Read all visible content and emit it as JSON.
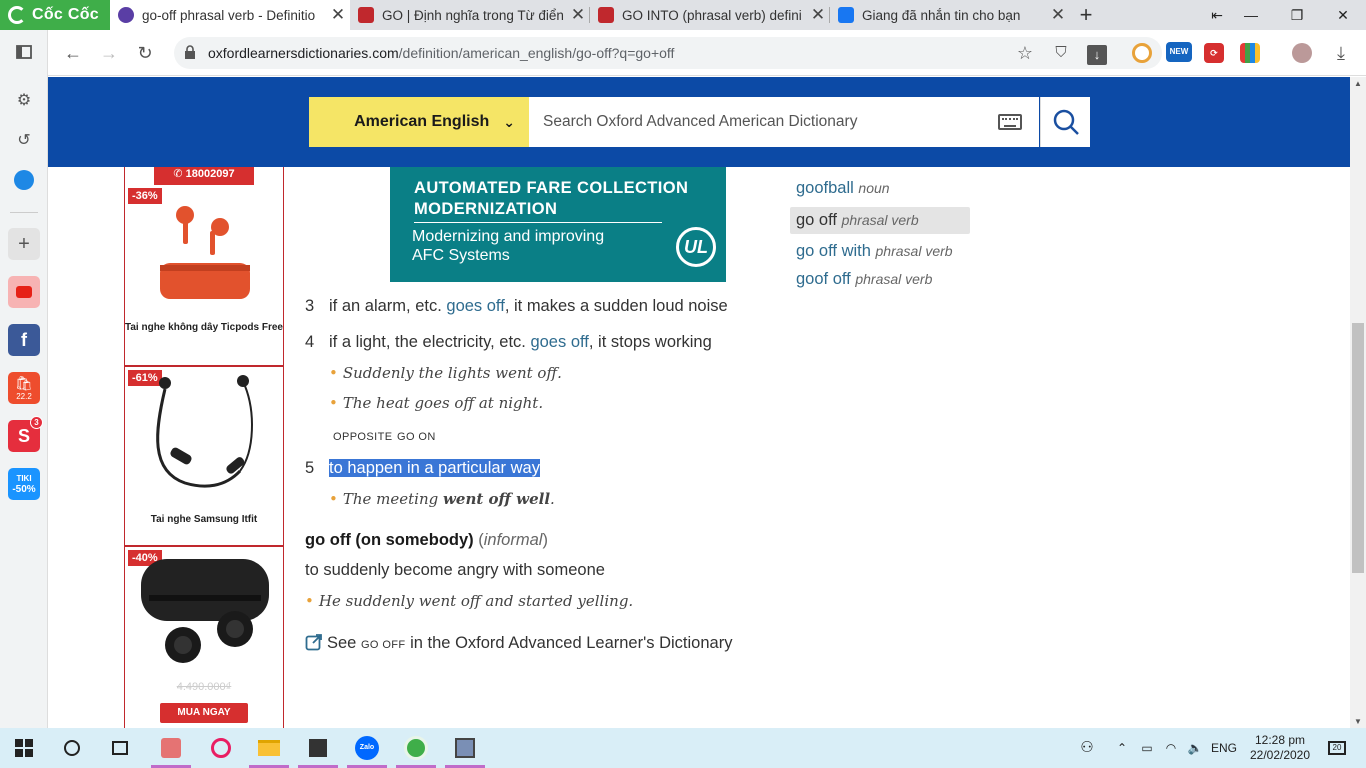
{
  "browser": {
    "brand": "Cốc Cốc",
    "tabs": [
      {
        "title": "go-off phrasal verb - Definitio",
        "favicon_color": "#5a3ea5",
        "active": true
      },
      {
        "title": "GO | Định nghĩa trong Từ điển",
        "favicon_color": "#c0282d",
        "active": false
      },
      {
        "title": "GO INTO (phrasal verb) defini",
        "favicon_color": "#c0282d",
        "active": false
      },
      {
        "title": "Giang đã nhắn tin cho bạn",
        "favicon_color": "#1877f2",
        "active": false
      }
    ],
    "url_host": "oxfordlearnersdictionaries.com",
    "url_path": "/definition/american_english/go-off?q=go+off",
    "ext_new_label": "NEW"
  },
  "sidebar_apps": {
    "shopee_badge": "22.2",
    "sendo_count": "3",
    "tiki_label": "TIKI",
    "tiki_pct": "-50%"
  },
  "header": {
    "dictionary": "American English",
    "search_placeholder": "Search Oxford Advanced American Dictionary"
  },
  "ads": {
    "hotline": "18002097",
    "items": [
      {
        "discount": "-36%",
        "name": "Tai nghe không dây Ticpods Free"
      },
      {
        "discount": "-61%",
        "name": "Tai nghe Samsung Itfit"
      },
      {
        "discount": "-40%",
        "old_price": "4.490.000₫",
        "button": "MUA NGAY"
      }
    ]
  },
  "banner": {
    "heading1": "AUTOMATED FARE COLLECTION",
    "heading2": "MODERNIZATION",
    "sub1": "Modernizing and improving",
    "sub2": "AFC Systems",
    "logo": "UL"
  },
  "entry": {
    "sense3": {
      "num": "3",
      "pre": "if an alarm, etc. ",
      "link": "goes off",
      "post": ", it makes a sudden loud noise"
    },
    "sense4": {
      "num": "4",
      "pre": "if a light, the electricity, etc. ",
      "link": "goes off",
      "post": ", it stops working",
      "examples": [
        "Suddenly the lights went off.",
        "The heat goes off at night."
      ],
      "opposite_label": "OPPOSITE",
      "opposite_word": "GO ON"
    },
    "sense5": {
      "num": "5",
      "def": "to happen in a particular way",
      "ex_pre": "The meeting ",
      "ex_bold": "went off well",
      "ex_post": "."
    },
    "idiom": {
      "phrase": "go off (on somebody)",
      "label_open": "(",
      "label": "informal",
      "label_close": ")",
      "def": "to suddenly become angry with someone",
      "example": "He suddenly went off and started yelling."
    },
    "see_also": {
      "pre": "See ",
      "word": "GO OFF",
      "post": " in the Oxford Advanced Learner's Dictionary"
    }
  },
  "word_list": [
    {
      "word": "goofball",
      "pos": "noun"
    },
    {
      "word": "go off",
      "pos": "phrasal verb",
      "current": true
    },
    {
      "word": "go off with",
      "pos": "phrasal verb"
    },
    {
      "word": "goof off",
      "pos": "phrasal verb"
    }
  ],
  "taskbar": {
    "zalo_label": "Zalo",
    "lang": "ENG",
    "time": "12:28 pm",
    "date": "22/02/2020",
    "notifications": "20"
  }
}
